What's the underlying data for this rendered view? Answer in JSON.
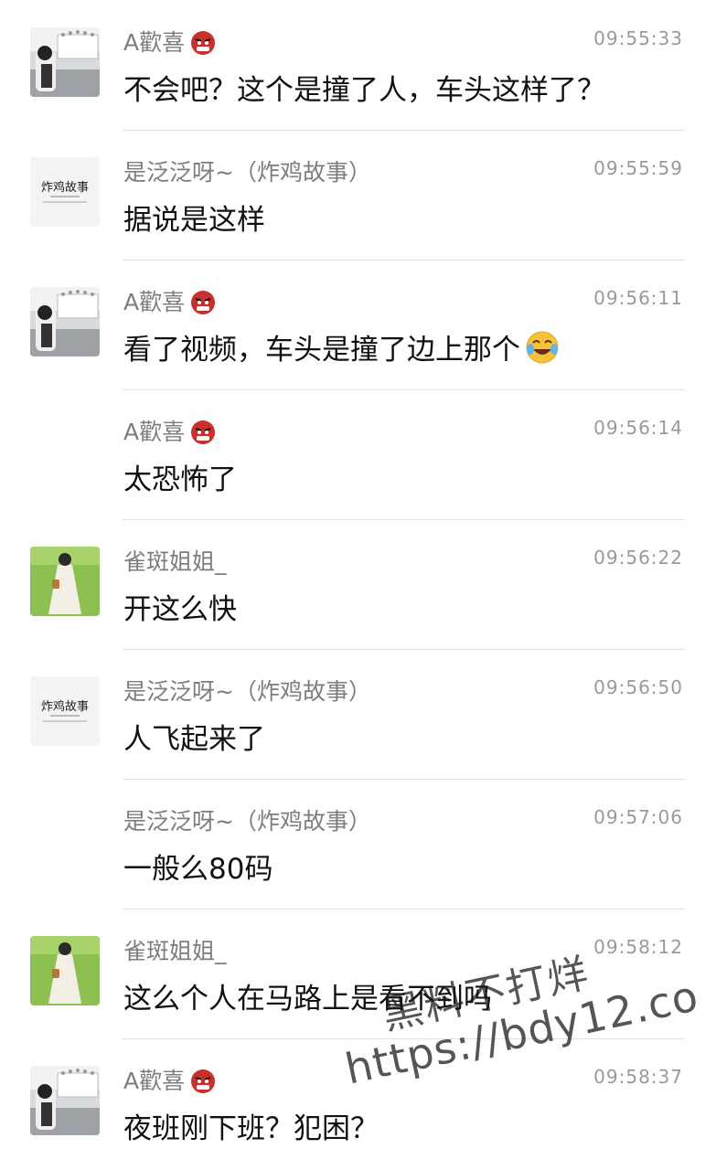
{
  "messages": [
    {
      "sender": "A歡喜",
      "avatar": "street-photo-avatar",
      "time": "09:55:33",
      "text": "不会吧？这个是撞了人，车头这样了？",
      "badge": "ogre-emoji"
    },
    {
      "sender": "是泛泛呀~（炸鸡故事）",
      "avatar": "zhaji-logo-avatar",
      "time": "09:55:59",
      "text": "据说是这样"
    },
    {
      "sender": "A歡喜",
      "avatar": "street-photo-avatar",
      "time": "09:56:11",
      "text": "看了视频，车头是撞了边上那个",
      "badge": "ogre-emoji",
      "trail": "laughing-crying-emoji"
    },
    {
      "sender": "A歡喜",
      "avatar": "",
      "time": "09:56:14",
      "text": "太恐怖了",
      "badge": "ogre-emoji"
    },
    {
      "sender": "雀斑姐姐_",
      "avatar": "grass-dress-avatar",
      "time": "09:56:22",
      "text": "开这么快"
    },
    {
      "sender": "是泛泛呀~（炸鸡故事）",
      "avatar": "zhaji-logo-avatar",
      "time": "09:56:50",
      "text": "人飞起来了"
    },
    {
      "sender": "是泛泛呀~（炸鸡故事）",
      "avatar": "",
      "time": "09:57:06",
      "text": "一般么80码"
    },
    {
      "sender": "雀斑姐姐_",
      "avatar": "grass-dress-avatar",
      "time": "09:58:12",
      "text": "这么个人在马路上是看不到吗"
    },
    {
      "sender": "A歡喜",
      "avatar": "street-photo-avatar",
      "time": "09:58:37",
      "text": "夜班刚下班？犯困？",
      "badge": "ogre-emoji"
    }
  ],
  "avatar_logo_text": "炸鸡故事",
  "watermark": {
    "line1": "黑料不打烊",
    "line2": "https://bdy12.co"
  },
  "colors": {
    "name": "#7d7d7d",
    "time": "#9a9a9a",
    "text": "#111111",
    "divider": "#e3e3e3"
  }
}
